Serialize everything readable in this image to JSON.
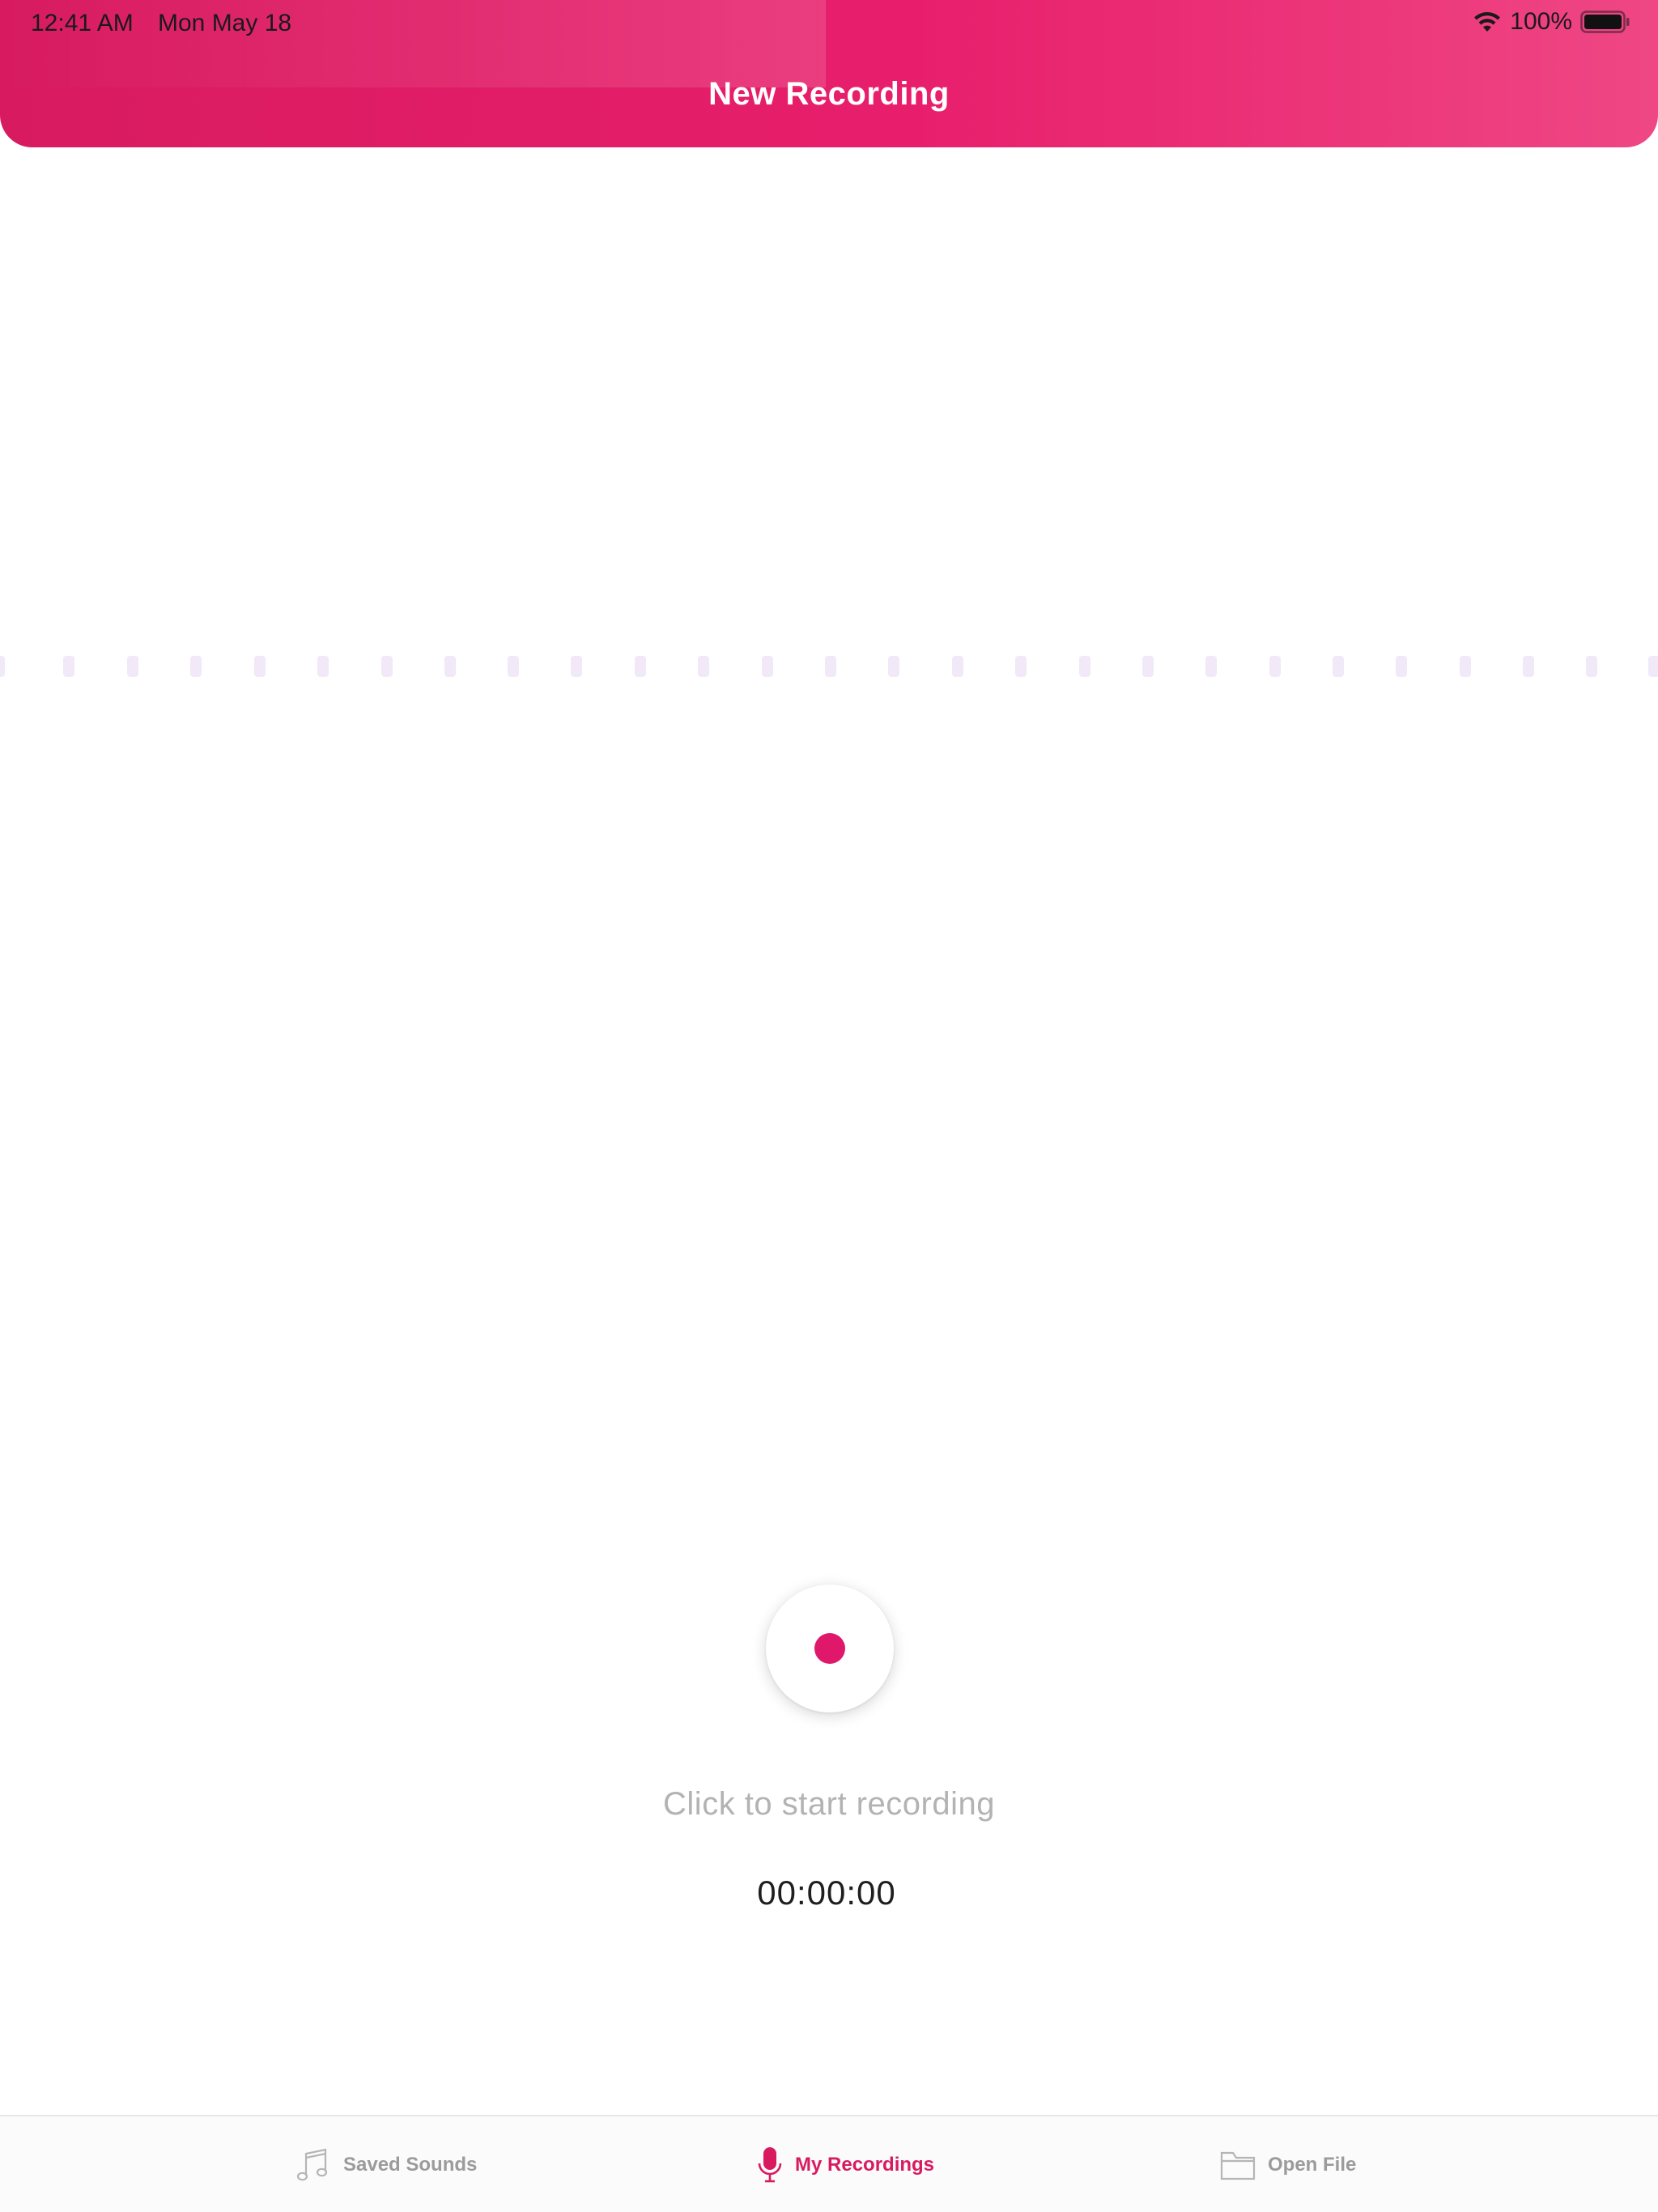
{
  "status_bar": {
    "time": "12:41 AM",
    "date": "Mon May 18",
    "battery_percent": "100%",
    "wifi_icon": "wifi-icon",
    "battery_icon": "battery-full-icon"
  },
  "header": {
    "title": "New Recording",
    "gradient": [
      "#d81b60",
      "#e81e6c",
      "#ef4784"
    ]
  },
  "waveform": {
    "dot_count": 27,
    "dot_color": "#f1e9f7"
  },
  "recorder": {
    "button_icon": "record-icon",
    "accent_color": "#e0186c",
    "hint": "Click to start recording",
    "elapsed": "00:00:00"
  },
  "tabbar": {
    "tabs": [
      {
        "label": "Saved Sounds",
        "icon": "music-note-icon",
        "active": false
      },
      {
        "label": "My Recordings",
        "icon": "microphone-icon",
        "active": true
      },
      {
        "label": "Open File",
        "icon": "folder-icon",
        "active": false
      }
    ],
    "active_color": "#d81b60",
    "inactive_color": "#9b9b9b"
  }
}
